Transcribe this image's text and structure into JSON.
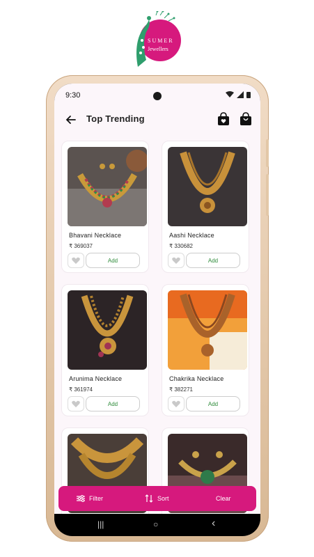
{
  "brand": {
    "line1": "SUMER",
    "line2": "Jewellers",
    "primary_color": "#d6197d",
    "accent_color": "#2f9e6d"
  },
  "status_bar": {
    "time": "9:30"
  },
  "header": {
    "title": "Top Trending",
    "back_icon": "arrow-left-icon",
    "icons": [
      "wishlist-bag-icon",
      "shopping-bag-icon"
    ]
  },
  "products": [
    {
      "name": "Bhavani Necklace",
      "price": "₹ 369037",
      "add_label": "Add"
    },
    {
      "name": "Aashi Necklace",
      "price": "₹ 330682",
      "add_label": "Add"
    },
    {
      "name": "Arunima Necklace",
      "price": "₹ 361974",
      "add_label": "Add"
    },
    {
      "name": "Chakrika Necklace",
      "price": "₹ 382271",
      "add_label": "Add"
    },
    {
      "name": "",
      "price": "",
      "add_label": ""
    },
    {
      "name": "",
      "price": "",
      "add_label": ""
    }
  ],
  "bottom_bar": {
    "filter_label": "Filter",
    "sort_label": "Sort",
    "clear_label": "Clear"
  },
  "system_nav": {
    "recents": "|||",
    "home": "○",
    "back": "‹"
  }
}
